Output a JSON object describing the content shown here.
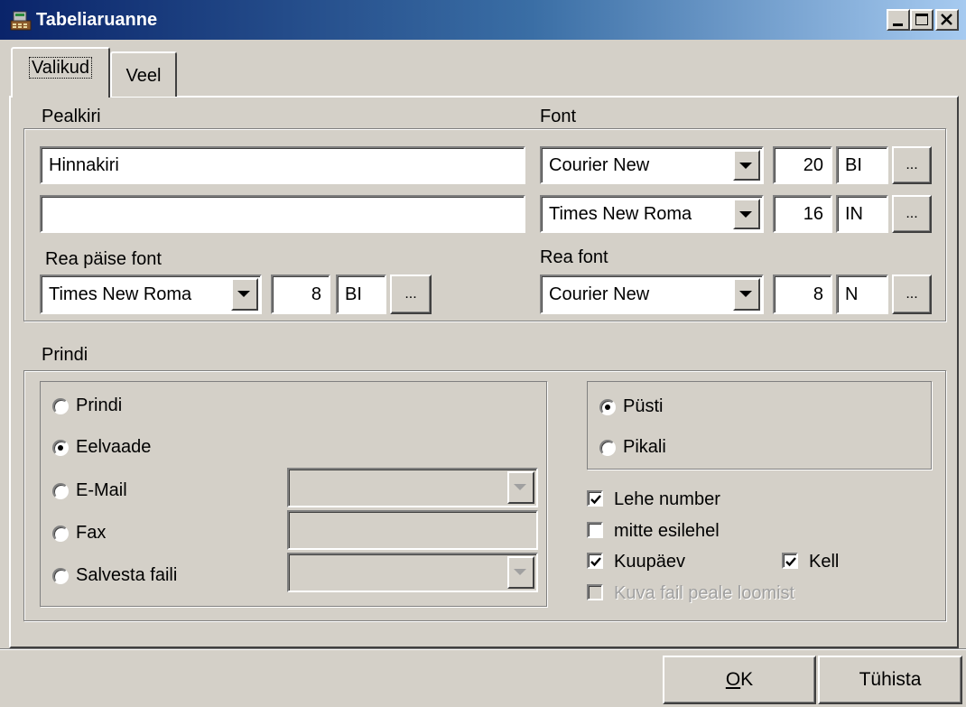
{
  "window": {
    "title": "Tabeliaruanne",
    "icon": "cash-register-icon",
    "controls": [
      "minimize",
      "maximize",
      "close"
    ]
  },
  "tabs": [
    {
      "label": "Valikud",
      "active": true
    },
    {
      "label": "Veel",
      "active": false
    }
  ],
  "header_section": {
    "title_label": "Pealkiri",
    "font_label": "Font",
    "title1_value": "Hinnakiri",
    "title2_value": "",
    "font1": {
      "name": "Courier New",
      "size": "20",
      "style": "BI"
    },
    "font2": {
      "name": "Times New Roma",
      "size": "16",
      "style": "IN"
    },
    "row_header_font_label": "Rea päise font",
    "row_header_font": {
      "name": "Times New Roma",
      "size": "8",
      "style": "BI"
    },
    "row_font_label": "Rea font",
    "row_font": {
      "name": "Courier New",
      "size": "8",
      "style": "N"
    },
    "more_button_label": "..."
  },
  "print_section": {
    "label": "Prindi",
    "destinations": [
      {
        "label": "Prindi",
        "selected": false
      },
      {
        "label": "Eelvaade",
        "selected": true
      },
      {
        "label": "E-Mail",
        "selected": false
      },
      {
        "label": "Fax",
        "selected": false
      },
      {
        "label": "Salvesta faili",
        "selected": false
      }
    ],
    "orientation": [
      {
        "label": "Püsti",
        "selected": true
      },
      {
        "label": "Pikali",
        "selected": false
      }
    ],
    "checkboxes": {
      "page_number": {
        "label": "Lehe number",
        "checked": true
      },
      "not_first_page": {
        "label": "mitte esilehel",
        "checked": false
      },
      "date": {
        "label": "Kuupäev",
        "checked": true
      },
      "time": {
        "label": "Kell",
        "checked": true
      },
      "show_file": {
        "label": "Kuva fail peale loomist",
        "checked": false,
        "disabled": true
      }
    }
  },
  "footer": {
    "ok_label": "OK",
    "ok_mnemonic": "O",
    "ok_rest": "K",
    "cancel_label": "Tühista"
  }
}
